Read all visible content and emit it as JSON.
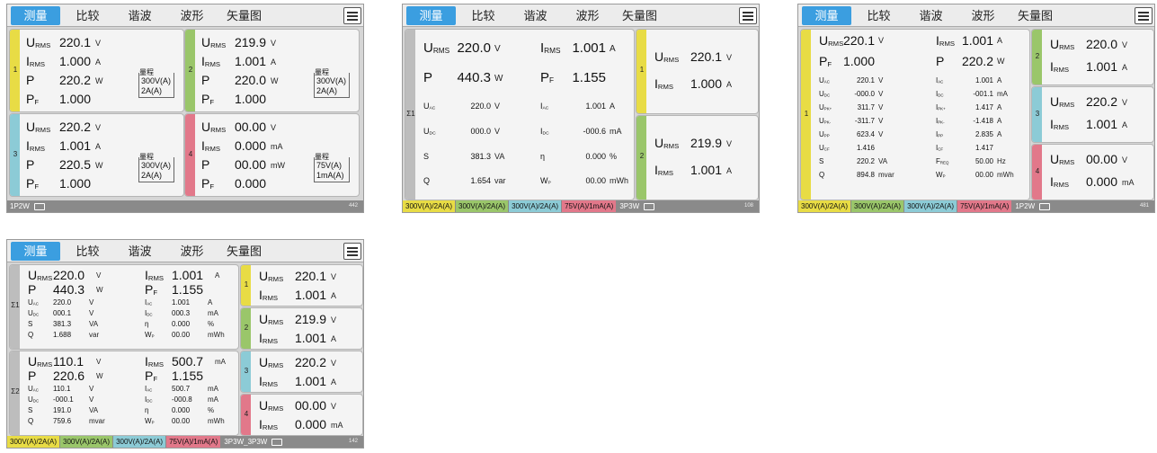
{
  "tabs": [
    "测量",
    "比较",
    "谐波",
    "波形",
    "矢量图"
  ],
  "colors": {
    "active_tab": "#3b9ee0",
    "ch1": "#e8dc45",
    "ch2": "#9ac66a",
    "ch3": "#8ccbd6",
    "ch4": "#e2788a"
  },
  "icons": {
    "menu": "list-menu-icon",
    "usb": "usb-icon"
  },
  "screen1": {
    "cells": [
      {
        "ch": "1",
        "rows": [
          [
            "URMS",
            "220.1",
            "V"
          ],
          [
            "IRMS",
            "1.000",
            "A"
          ],
          [
            "P",
            "220.2",
            "W"
          ],
          [
            "PF",
            "1.000",
            ""
          ]
        ],
        "range_title": "量程",
        "range": [
          "300V(A)",
          "2A(A)"
        ]
      },
      {
        "ch": "2",
        "rows": [
          [
            "URMS",
            "219.9",
            "V"
          ],
          [
            "IRMS",
            "1.001",
            "A"
          ],
          [
            "P",
            "220.0",
            "W"
          ],
          [
            "PF",
            "1.000",
            ""
          ]
        ],
        "range_title": "量程",
        "range": [
          "300V(A)",
          "2A(A)"
        ]
      },
      {
        "ch": "3",
        "rows": [
          [
            "URMS",
            "220.2",
            "V"
          ],
          [
            "IRMS",
            "1.001",
            "A"
          ],
          [
            "P",
            "220.5",
            "W"
          ],
          [
            "PF",
            "1.000",
            ""
          ]
        ],
        "range_title": "量程",
        "range": [
          "300V(A)",
          "2A(A)"
        ]
      },
      {
        "ch": "4",
        "rows": [
          [
            "URMS",
            "00.00",
            "V"
          ],
          [
            "IRMS",
            "0.000",
            "mA"
          ],
          [
            "P",
            "00.00",
            "mW"
          ],
          [
            "PF",
            "0.000",
            ""
          ]
        ],
        "range_title": "量程",
        "range": [
          "75V(A)",
          "1mA(A)"
        ]
      }
    ],
    "status_text": "1P2W",
    "status_num": "442"
  },
  "screen2": {
    "sigma": "Σ1",
    "left": [
      [
        "URMS",
        "220.0",
        "V"
      ],
      [
        "P",
        "440.3",
        "W"
      ],
      [
        "UAC",
        "220.0",
        "V"
      ],
      [
        "UDC",
        "000.0",
        "V"
      ],
      [
        "S",
        "381.3",
        "VA"
      ],
      [
        "Q",
        "1.654",
        "var"
      ]
    ],
    "right": [
      [
        "IRMS",
        "1.001",
        "A"
      ],
      [
        "PF",
        "1.155",
        ""
      ],
      [
        "IAC",
        "1.001",
        "A"
      ],
      [
        "IDC",
        "-000.6",
        "mA"
      ],
      [
        "η",
        "0.000",
        "%"
      ],
      [
        "WP",
        "00.00",
        "mWh"
      ]
    ],
    "channels": [
      {
        "ch": "1",
        "rows": [
          [
            "URMS",
            "220.1",
            "V"
          ],
          [
            "IRMS",
            "1.000",
            "A"
          ]
        ]
      },
      {
        "ch": "2",
        "rows": [
          [
            "URMS",
            "219.9",
            "V"
          ],
          [
            "IRMS",
            "1.001",
            "A"
          ]
        ]
      }
    ],
    "status_chips": [
      "300V(A)/2A(A)",
      "300V(A)/2A(A)",
      "300V(A)/2A(A)",
      "75V(A)/1mA(A)"
    ],
    "status_text": "3P3W",
    "status_num": "108"
  },
  "screen3": {
    "ch": "1",
    "left": [
      [
        "URMS",
        "220.1",
        "V"
      ],
      [
        "PF",
        "1.000",
        ""
      ],
      [
        "UAC",
        "220.1",
        "V"
      ],
      [
        "UDC",
        "-000.0",
        "V"
      ],
      [
        "UPK+",
        "311.7",
        "V"
      ],
      [
        "UPK-",
        "-311.7",
        "V"
      ],
      [
        "UPP",
        "623.4",
        "V"
      ],
      [
        "UCF",
        "1.416",
        ""
      ],
      [
        "S",
        "220.2",
        "VA"
      ],
      [
        "Q",
        "894.8",
        "mvar"
      ]
    ],
    "right": [
      [
        "IRMS",
        "1.001",
        "A"
      ],
      [
        "P",
        "220.2",
        "W"
      ],
      [
        "IAC",
        "1.001",
        "A"
      ],
      [
        "IDC",
        "-001.1",
        "mA"
      ],
      [
        "IPK+",
        "1.417",
        "A"
      ],
      [
        "IPK-",
        "-1.418",
        "A"
      ],
      [
        "IPP",
        "2.835",
        "A"
      ],
      [
        "ICF",
        "1.417",
        ""
      ],
      [
        "FREQ",
        "50.00",
        "Hz"
      ],
      [
        "WP",
        "00.00",
        "mWh"
      ]
    ],
    "channels": [
      {
        "ch": "2",
        "rows": [
          [
            "URMS",
            "220.0",
            "V"
          ],
          [
            "IRMS",
            "1.001",
            "A"
          ]
        ]
      },
      {
        "ch": "3",
        "rows": [
          [
            "URMS",
            "220.2",
            "V"
          ],
          [
            "IRMS",
            "1.001",
            "A"
          ]
        ]
      },
      {
        "ch": "4",
        "rows": [
          [
            "URMS",
            "00.00",
            "V"
          ],
          [
            "IRMS",
            "0.000",
            "mA"
          ]
        ]
      }
    ],
    "status_chips": [
      "300V(A)/2A(A)",
      "300V(A)/2A(A)",
      "300V(A)/2A(A)",
      "75V(A)/1mA(A)"
    ],
    "status_text": "1P2W",
    "status_num": "481"
  },
  "screen4": {
    "groups": [
      {
        "sigma": "Σ1",
        "left": [
          [
            "URMS",
            "220.0",
            "V"
          ],
          [
            "P",
            "440.3",
            "W"
          ],
          [
            "UAC",
            "220.0",
            "V"
          ],
          [
            "UDC",
            "000.1",
            "V"
          ],
          [
            "S",
            "381.3",
            "VA"
          ],
          [
            "Q",
            "1.688",
            "var"
          ]
        ],
        "right": [
          [
            "IRMS",
            "1.001",
            "A"
          ],
          [
            "PF",
            "1.155",
            ""
          ],
          [
            "IAC",
            "1.001",
            "A"
          ],
          [
            "IDC",
            "000.3",
            "mA"
          ],
          [
            "η",
            "0.000",
            "%"
          ],
          [
            "WP",
            "00.00",
            "mWh"
          ]
        ]
      },
      {
        "sigma": "Σ2",
        "left": [
          [
            "URMS",
            "110.1",
            "V"
          ],
          [
            "P",
            "220.6",
            "W"
          ],
          [
            "UAC",
            "110.1",
            "V"
          ],
          [
            "UDC",
            "-000.1",
            "V"
          ],
          [
            "S",
            "191.0",
            "VA"
          ],
          [
            "Q",
            "759.6",
            "mvar"
          ]
        ],
        "right": [
          [
            "IRMS",
            "500.7",
            "mA"
          ],
          [
            "PF",
            "1.155",
            ""
          ],
          [
            "IAC",
            "500.7",
            "mA"
          ],
          [
            "IDC",
            "-000.8",
            "mA"
          ],
          [
            "η",
            "0.000",
            "%"
          ],
          [
            "WP",
            "00.00",
            "mWh"
          ]
        ]
      }
    ],
    "channels": [
      {
        "ch": "1",
        "rows": [
          [
            "URMS",
            "220.1",
            "V"
          ],
          [
            "IRMS",
            "1.001",
            "A"
          ]
        ]
      },
      {
        "ch": "2",
        "rows": [
          [
            "URMS",
            "219.9",
            "V"
          ],
          [
            "IRMS",
            "1.001",
            "A"
          ]
        ]
      },
      {
        "ch": "3",
        "rows": [
          [
            "URMS",
            "220.2",
            "V"
          ],
          [
            "IRMS",
            "1.001",
            "A"
          ]
        ]
      },
      {
        "ch": "4",
        "rows": [
          [
            "URMS",
            "00.00",
            "V"
          ],
          [
            "IRMS",
            "0.000",
            "mA"
          ]
        ]
      }
    ],
    "status_chips": [
      "300V(A)/2A(A)",
      "300V(A)/2A(A)",
      "300V(A)/2A(A)",
      "75V(A)/1mA(A)"
    ],
    "status_text": "3P3W_3P3W",
    "status_num": "142"
  }
}
